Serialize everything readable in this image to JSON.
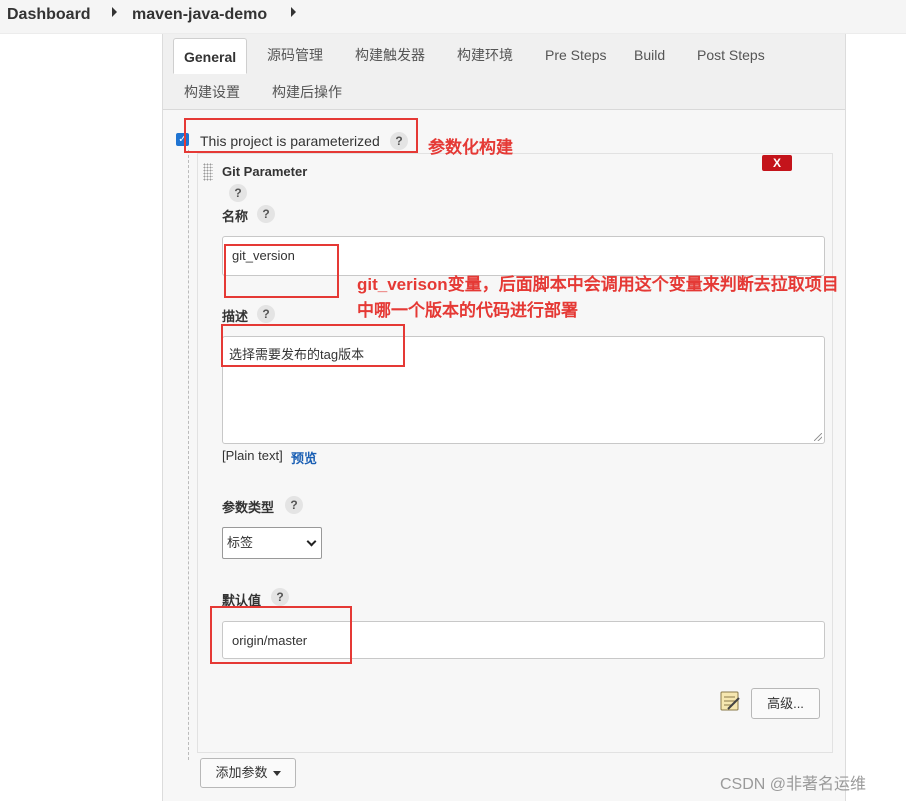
{
  "breadcrumb": {
    "items": [
      "Dashboard",
      "maven-java-demo"
    ]
  },
  "tabs": [
    {
      "label": "General"
    },
    {
      "label": "源码管理"
    },
    {
      "label": "构建触发器"
    },
    {
      "label": "构建环境"
    },
    {
      "label": "Pre Steps"
    },
    {
      "label": "Build"
    },
    {
      "label": "Post Steps"
    },
    {
      "label": "构建设置"
    },
    {
      "label": "构建后操作"
    }
  ],
  "general": {
    "parameterized_label": "This project is parameterized",
    "parameterized_checked": true,
    "help": "?"
  },
  "parameter": {
    "title": "Git Parameter",
    "delete_label": "X",
    "name_label": "名称",
    "name_value": "git_version",
    "desc_label": "描述",
    "desc_value": "选择需要发布的tag版本",
    "plain_text": "[Plain text]",
    "preview_label": "预览",
    "type_label": "参数类型",
    "type_value": "标签",
    "default_label": "默认值",
    "default_value": "origin/master",
    "advanced_label": "高级..."
  },
  "add_param_label": "添加参数",
  "annotations": {
    "parameterized": "参数化构建",
    "name_note_line1": "git_verison变量，后面脚本中会调用这个变量来判断去拉取项目",
    "name_note_line2": "中哪一个版本的代码进行部署"
  },
  "watermark": "CSDN @非著名运维",
  "colors": {
    "annotation": "#e53935",
    "link": "#1a5fb4",
    "delete": "#c4141b"
  }
}
